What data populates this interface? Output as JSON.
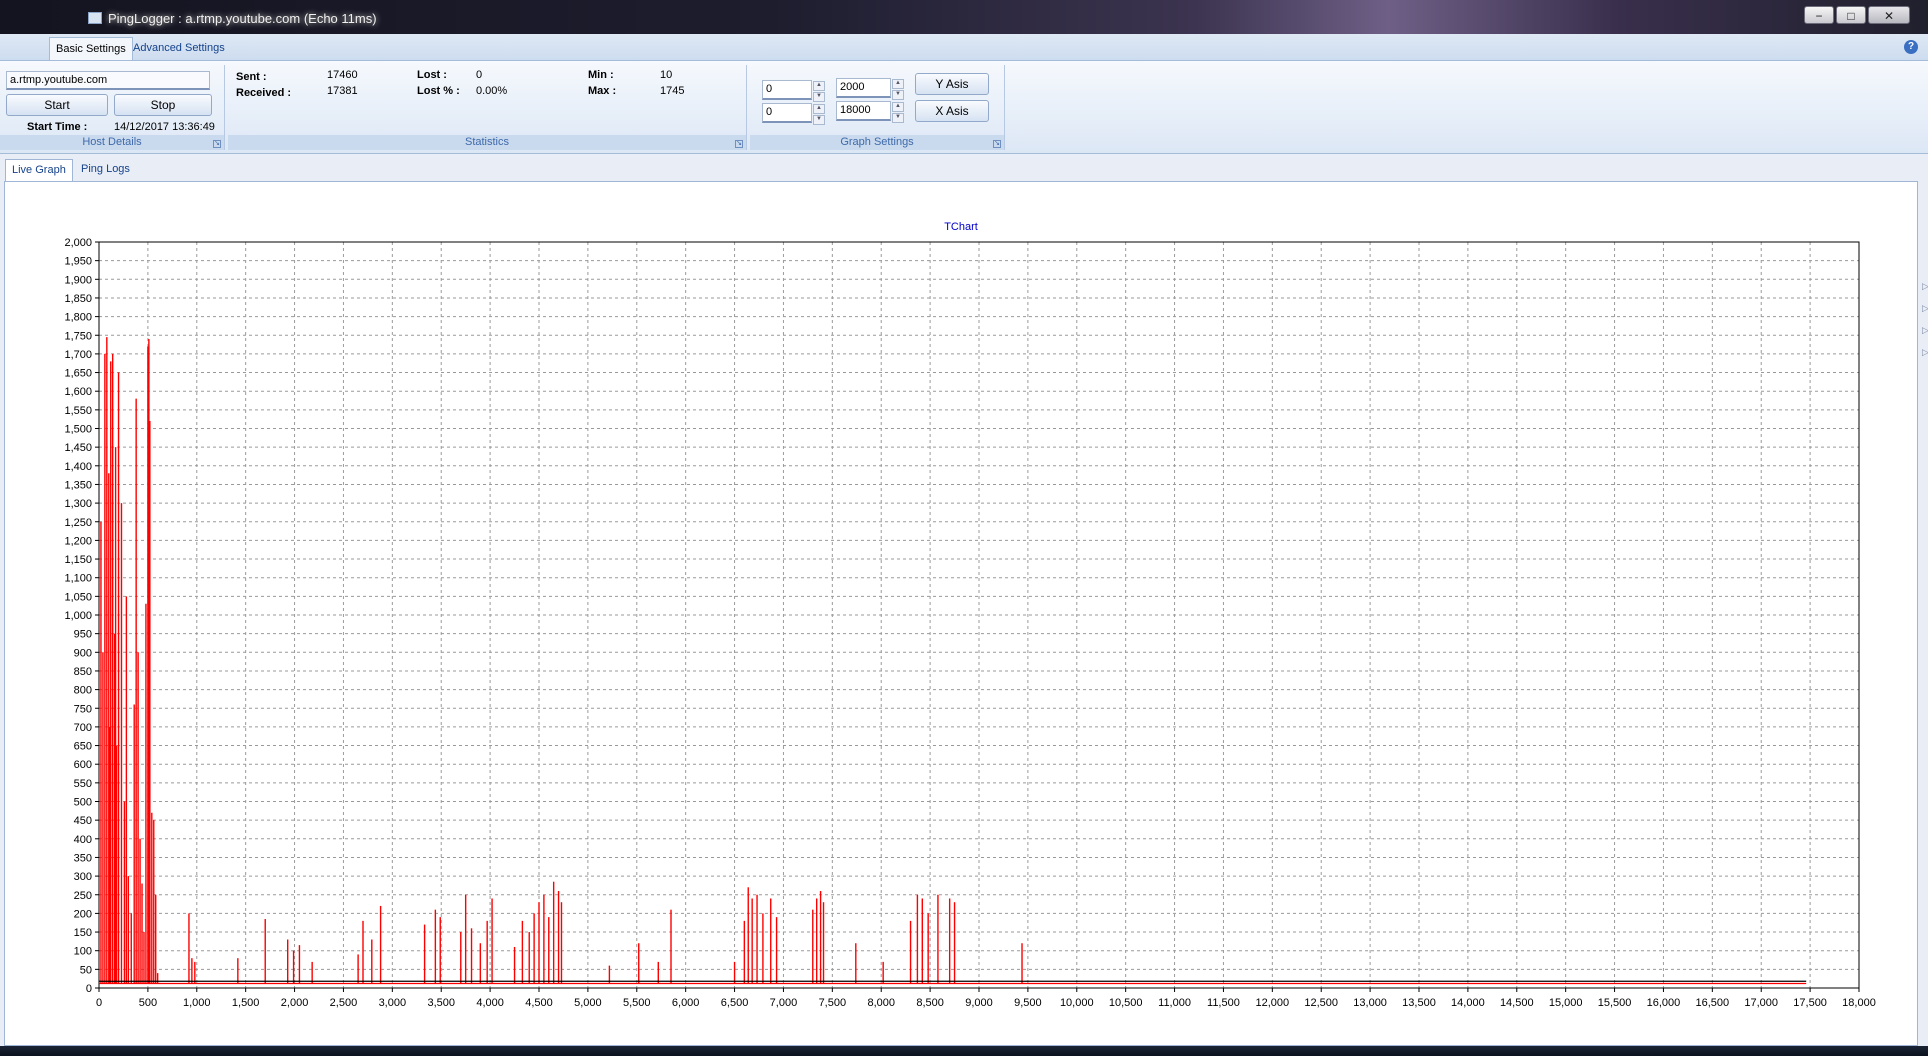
{
  "window": {
    "title": "PingLogger : a.rtmp.youtube.com (Echo 11ms)",
    "minimize": "−",
    "restore": "□",
    "close": "✕"
  },
  "ribbon": {
    "tabs": [
      {
        "label": "Basic Settings",
        "active": true
      },
      {
        "label": "Advanced Settings",
        "active": false
      }
    ],
    "help": "?",
    "host": {
      "value": "a.rtmp.youtube.com",
      "start_label": "Start",
      "stop_label": "Stop",
      "start_time_label": "Start Time :",
      "start_time_value": "14/12/2017 13:36:49",
      "caption": "Host Details"
    },
    "stats": {
      "sent_label": "Sent :",
      "sent_value": "17460",
      "received_label": "Received :",
      "received_value": "17381",
      "lost_label": "Lost :",
      "lost_value": "0",
      "lost_pct_label": "Lost % :",
      "lost_pct_value": "0.00%",
      "min_label": "Min :",
      "min_value": "10",
      "max_label": "Max :",
      "max_value": "1745",
      "caption": "Statistics"
    },
    "graph": {
      "y_min": "0",
      "y_max": "2000",
      "x_min": "0",
      "x_max": "18000",
      "y_button": "Y Asis",
      "x_button": "X Asis",
      "caption": "Graph Settings"
    }
  },
  "doc_tabs": [
    {
      "label": "Live Graph",
      "active": true
    },
    {
      "label": "Ping Logs",
      "active": false
    }
  ],
  "chart_data": {
    "type": "line",
    "title": "TChart",
    "xlabel": "",
    "ylabel": "",
    "xlim": [
      0,
      18000
    ],
    "ylim": [
      0,
      2000
    ],
    "grid": true,
    "x_ticks": [
      "0",
      "500",
      "1,000",
      "1,500",
      "2,000",
      "2,500",
      "3,000",
      "3,500",
      "4,000",
      "4,500",
      "5,000",
      "5,500",
      "6,000",
      "6,500",
      "7,000",
      "7,500",
      "8,000",
      "8,500",
      "9,000",
      "9,500",
      "10,000",
      "10,500",
      "11,000",
      "11,500",
      "12,000",
      "12,500",
      "13,000",
      "13,500",
      "14,000",
      "14,500",
      "15,000",
      "15,500",
      "16,000",
      "16,500",
      "17,000",
      "17,500",
      "18,000"
    ],
    "y_ticks": [
      "0",
      "50",
      "100",
      "150",
      "200",
      "250",
      "300",
      "350",
      "400",
      "450",
      "500",
      "550",
      "600",
      "650",
      "700",
      "750",
      "800",
      "850",
      "900",
      "950",
      "1,000",
      "1,050",
      "1,100",
      "1,150",
      "1,200",
      "1,250",
      "1,300",
      "1,350",
      "1,400",
      "1,450",
      "1,500",
      "1,550",
      "1,600",
      "1,650",
      "1,700",
      "1,750",
      "1,800",
      "1,850",
      "1,900",
      "1,950",
      "2,000"
    ],
    "series": [
      {
        "color": "#ff0000",
        "baseline": 12,
        "x_end": 17460,
        "spikes": [
          [
            20,
            1250
          ],
          [
            40,
            900
          ],
          [
            60,
            1700
          ],
          [
            80,
            1745
          ],
          [
            100,
            1380
          ],
          [
            110,
            700
          ],
          [
            120,
            1680
          ],
          [
            140,
            1700
          ],
          [
            160,
            950
          ],
          [
            170,
            1450
          ],
          [
            180,
            650
          ],
          [
            200,
            1650
          ],
          [
            230,
            1300
          ],
          [
            260,
            500
          ],
          [
            280,
            1050
          ],
          [
            300,
            300
          ],
          [
            330,
            200
          ],
          [
            360,
            760
          ],
          [
            380,
            1580
          ],
          [
            400,
            900
          ],
          [
            420,
            400
          ],
          [
            440,
            280
          ],
          [
            460,
            150
          ],
          [
            480,
            1030
          ],
          [
            500,
            1720
          ],
          [
            510,
            1740
          ],
          [
            520,
            1520
          ],
          [
            540,
            470
          ],
          [
            560,
            450
          ],
          [
            580,
            250
          ],
          [
            600,
            40
          ],
          [
            920,
            200
          ],
          [
            950,
            80
          ],
          [
            980,
            70
          ],
          [
            1420,
            80
          ],
          [
            1700,
            185
          ],
          [
            1930,
            130
          ],
          [
            1990,
            100
          ],
          [
            2050,
            115
          ],
          [
            2180,
            70
          ],
          [
            2650,
            90
          ],
          [
            2700,
            180
          ],
          [
            2790,
            130
          ],
          [
            2880,
            220
          ],
          [
            3330,
            170
          ],
          [
            3440,
            210
          ],
          [
            3490,
            190
          ],
          [
            3700,
            150
          ],
          [
            3750,
            250
          ],
          [
            3810,
            160
          ],
          [
            3900,
            120
          ],
          [
            3970,
            180
          ],
          [
            4020,
            240
          ],
          [
            4250,
            110
          ],
          [
            4330,
            180
          ],
          [
            4400,
            150
          ],
          [
            4450,
            200
          ],
          [
            4500,
            230
          ],
          [
            4550,
            250
          ],
          [
            4600,
            190
          ],
          [
            4650,
            285
          ],
          [
            4700,
            260
          ],
          [
            4730,
            230
          ],
          [
            5220,
            60
          ],
          [
            5520,
            120
          ],
          [
            5720,
            70
          ],
          [
            5850,
            210
          ],
          [
            6500,
            70
          ],
          [
            6600,
            180
          ],
          [
            6640,
            270
          ],
          [
            6680,
            240
          ],
          [
            6730,
            250
          ],
          [
            6790,
            200
          ],
          [
            6870,
            240
          ],
          [
            6930,
            190
          ],
          [
            7300,
            210
          ],
          [
            7340,
            240
          ],
          [
            7380,
            260
          ],
          [
            7410,
            230
          ],
          [
            7740,
            120
          ],
          [
            8020,
            70
          ],
          [
            8300,
            180
          ],
          [
            8370,
            250
          ],
          [
            8420,
            240
          ],
          [
            8480,
            200
          ],
          [
            8580,
            250
          ],
          [
            8700,
            240
          ],
          [
            8750,
            230
          ],
          [
            9440,
            120
          ]
        ]
      },
      {
        "color": "#000000",
        "baseline": 18,
        "x_end": 17460,
        "spikes": []
      }
    ]
  }
}
